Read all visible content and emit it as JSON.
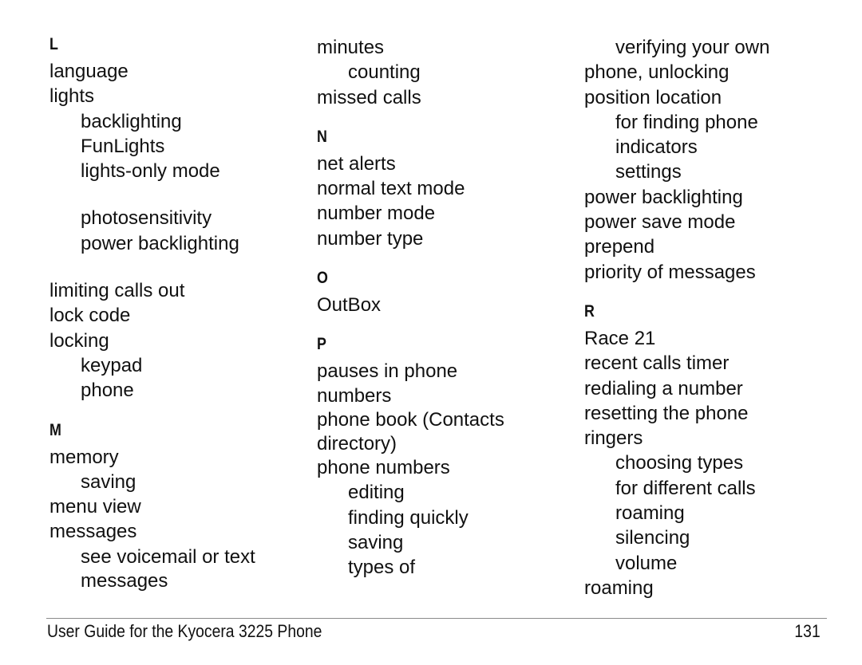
{
  "columns": [
    {
      "entries": [
        {
          "type": "heading",
          "text": "L"
        },
        {
          "type": "main",
          "text": "language"
        },
        {
          "type": "main",
          "text": "lights"
        },
        {
          "type": "sub",
          "text": "backlighting"
        },
        {
          "type": "sub",
          "text": "FunLights"
        },
        {
          "type": "sub",
          "text": "lights-only mode"
        },
        {
          "type": "sub",
          "text": "photosensitivity",
          "gap": true
        },
        {
          "type": "sub",
          "text": "power backlighting"
        },
        {
          "type": "main",
          "text": "limiting calls out",
          "gap": true
        },
        {
          "type": "main",
          "text": "lock code"
        },
        {
          "type": "main",
          "text": "locking"
        },
        {
          "type": "sub",
          "text": "keypad"
        },
        {
          "type": "sub",
          "text": "phone"
        },
        {
          "type": "heading",
          "text": "M",
          "gap": true
        },
        {
          "type": "main",
          "text": "memory"
        },
        {
          "type": "sub",
          "text": "saving"
        },
        {
          "type": "main",
          "text": "menu view"
        },
        {
          "type": "main",
          "text": "messages"
        },
        {
          "type": "sub",
          "text": "see voicemail or text"
        },
        {
          "type": "sub",
          "text": "messages",
          "tight": true
        }
      ]
    },
    {
      "entries": [
        {
          "type": "main",
          "text": "minutes"
        },
        {
          "type": "sub",
          "text": "counting"
        },
        {
          "type": "main",
          "text": "missed calls"
        },
        {
          "type": "heading",
          "text": "N",
          "gap": true
        },
        {
          "type": "main",
          "text": "net alerts"
        },
        {
          "type": "main",
          "text": "normal text mode"
        },
        {
          "type": "main",
          "text": "number mode"
        },
        {
          "type": "main",
          "text": "number type"
        },
        {
          "type": "heading",
          "text": "O",
          "gap": true
        },
        {
          "type": "main",
          "text": "OutBox"
        },
        {
          "type": "heading",
          "text": "P",
          "gap": true
        },
        {
          "type": "main",
          "text": "pauses in phone"
        },
        {
          "type": "main",
          "text": "numbers",
          "tight": true
        },
        {
          "type": "main",
          "text": "phone book (Contacts"
        },
        {
          "type": "main",
          "text": "directory)",
          "tight": true
        },
        {
          "type": "main",
          "text": "phone numbers"
        },
        {
          "type": "sub",
          "text": "editing"
        },
        {
          "type": "sub",
          "text": "finding quickly"
        },
        {
          "type": "sub",
          "text": "saving"
        },
        {
          "type": "sub",
          "text": "types of"
        }
      ]
    },
    {
      "entries": [
        {
          "type": "sub",
          "text": "verifying your own"
        },
        {
          "type": "main",
          "text": "phone, unlocking"
        },
        {
          "type": "main",
          "text": "position location"
        },
        {
          "type": "sub",
          "text": "for finding phone"
        },
        {
          "type": "sub",
          "text": "indicators"
        },
        {
          "type": "sub",
          "text": "settings"
        },
        {
          "type": "main",
          "text": "power backlighting"
        },
        {
          "type": "main",
          "text": "power save mode"
        },
        {
          "type": "main",
          "text": "prepend"
        },
        {
          "type": "main",
          "text": "priority of messages"
        },
        {
          "type": "heading",
          "text": "R",
          "gap": true
        },
        {
          "type": "main",
          "text": "Race 21"
        },
        {
          "type": "main",
          "text": "recent calls timer"
        },
        {
          "type": "main",
          "text": "redialing a number"
        },
        {
          "type": "main",
          "text": "resetting the phone"
        },
        {
          "type": "main",
          "text": "ringers"
        },
        {
          "type": "sub",
          "text": "choosing types"
        },
        {
          "type": "sub",
          "text": "for different calls"
        },
        {
          "type": "sub",
          "text": "roaming"
        },
        {
          "type": "sub",
          "text": "silencing"
        },
        {
          "type": "sub",
          "text": "volume"
        },
        {
          "type": "main",
          "text": "roaming"
        }
      ]
    }
  ],
  "footer": {
    "title": "User Guide for the Kyocera 3225 Phone",
    "page_number": "131"
  }
}
